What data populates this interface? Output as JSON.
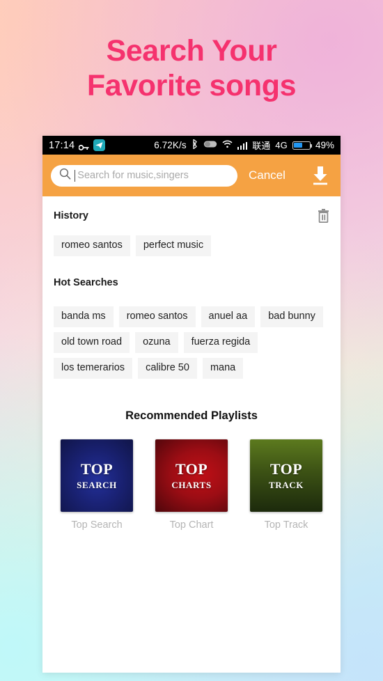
{
  "promo": {
    "heading_line1": "Search Your",
    "heading_line2": "Favorite songs",
    "heading_color": "#f5326e"
  },
  "status_bar": {
    "time": "17:14",
    "key_icon": "key-icon",
    "app_icon": "telegram-icon",
    "network_speed": "6.72K/s",
    "bluetooth_icon": "bluetooth-icon",
    "capsule_icon": "capsule-icon",
    "wifi_icon": "wifi-icon",
    "signal_icon": "signal-bars-icon",
    "carrier": "联通",
    "network_type": "4G",
    "battery_icon": "battery-icon",
    "battery_percent": "49%",
    "battery_level": 49,
    "background": "#000000"
  },
  "search_bar": {
    "background": "#f5a243",
    "search_icon": "search-icon",
    "placeholder": "Search for music,singers",
    "value": "",
    "cancel_label": "Cancel",
    "download_icon": "download-icon"
  },
  "history": {
    "title": "History",
    "clear_icon": "trash-icon",
    "items": [
      "romeo santos",
      "perfect music"
    ]
  },
  "hot_searches": {
    "title": "Hot Searches",
    "items": [
      "banda ms",
      "romeo santos",
      "anuel aa",
      "bad bunny",
      "old town road",
      "ozuna",
      "fuerza regida",
      "los temerarios",
      "calibre 50",
      "mana"
    ]
  },
  "playlists": {
    "title": "Recommended Playlists",
    "items": [
      {
        "cover_top": "TOP",
        "cover_sub": "SEARCH",
        "label": "Top Search",
        "color": "#1a2275"
      },
      {
        "cover_top": "TOP",
        "cover_sub": "CHARTS",
        "label": "Top Chart",
        "color": "#9c0d14"
      },
      {
        "cover_top": "TOP",
        "cover_sub": "TRACK",
        "label": "Top Track",
        "color": "#3e5415"
      }
    ]
  }
}
